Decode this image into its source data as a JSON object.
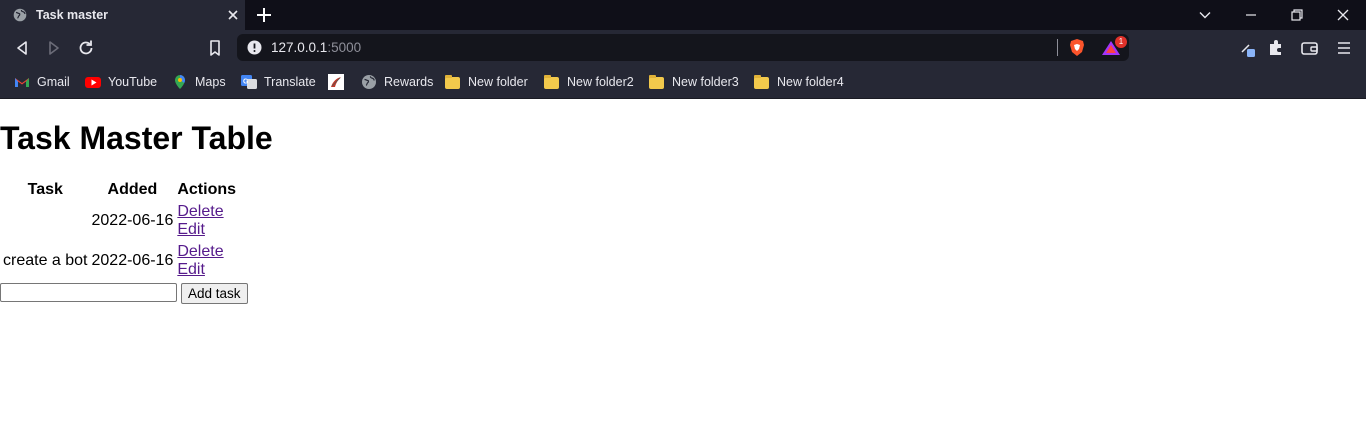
{
  "browser": {
    "tab_title": "Task master",
    "url_host": "127.0.0.1",
    "url_port": ":5000",
    "notification_count": "1",
    "bookmarks": [
      {
        "label": "Gmail",
        "icon": "gmail-icon"
      },
      {
        "label": "YouTube",
        "icon": "youtube-icon"
      },
      {
        "label": "Maps",
        "icon": "maps-icon"
      },
      {
        "label": "Translate",
        "icon": "translate-icon"
      },
      {
        "label": "",
        "icon": "bookmark-site-icon"
      },
      {
        "label": "Rewards",
        "icon": "globe-icon"
      },
      {
        "label": "New folder",
        "icon": "folder-icon"
      },
      {
        "label": "New folder2",
        "icon": "folder-icon"
      },
      {
        "label": "New folder3",
        "icon": "folder-icon"
      },
      {
        "label": "New folder4",
        "icon": "folder-icon"
      }
    ],
    "colors": {
      "tabstrip": "#0f0f18",
      "toolbar": "#262835",
      "omnibox": "#14151c",
      "brave_orange": "#fb542b"
    }
  },
  "page": {
    "heading": "Task Master Table",
    "columns": [
      "Task",
      "Added",
      "Actions"
    ],
    "rows": [
      {
        "task": "",
        "added": "2022-06-16",
        "delete_label": "Delete",
        "edit_label": "Edit"
      },
      {
        "task": "create a bot",
        "added": "2022-06-16",
        "delete_label": "Delete",
        "edit_label": "Edit"
      }
    ],
    "form": {
      "input_value": "",
      "submit_label": "Add task"
    },
    "link_color": "#551a8b"
  }
}
